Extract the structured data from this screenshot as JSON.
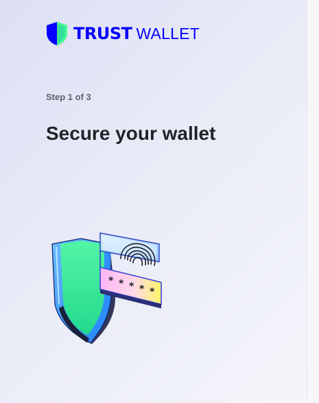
{
  "brand": {
    "name_bold": "TRUST",
    "name_regular": "WALLET",
    "color": "#0500ff"
  },
  "onboarding": {
    "step_label": "Step 1 of 3",
    "title": "Secure your wallet"
  },
  "illustration": {
    "name": "shield-fingerprint-password-icon",
    "password_mask": "* * * * *"
  },
  "colors": {
    "title": "#222327",
    "step": "#5f6169",
    "shield_green": "#35e584",
    "shield_blue": "#2a8cff"
  }
}
